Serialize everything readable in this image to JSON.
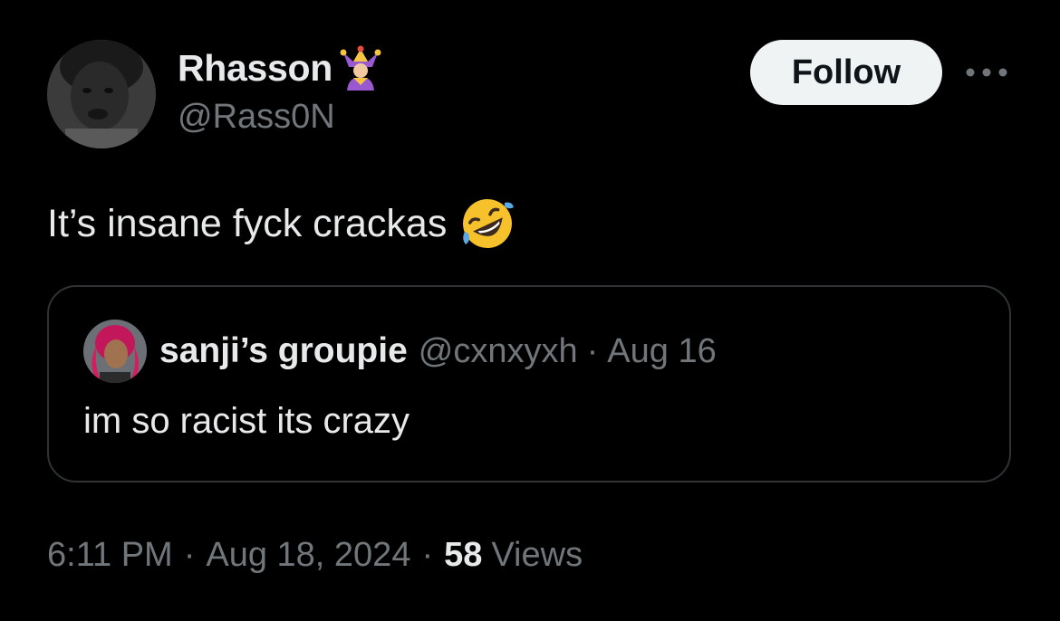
{
  "author": {
    "display_name": "Rhasson",
    "badge_icon": "jester-icon",
    "handle": "@Rass0N",
    "avatar_icon": "avatar-photo"
  },
  "actions": {
    "follow_label": "Follow",
    "more_icon": "more-horizontal-icon"
  },
  "tweet": {
    "text": "It’s insane fyck crackas",
    "emoji_icon": "rolling-on-floor-laughing-icon"
  },
  "quote": {
    "display_name": "sanji’s groupie",
    "handle": "@cxnxyxh",
    "separator": "·",
    "date": "Aug 16",
    "text": "im so racist its crazy"
  },
  "meta": {
    "time": "6:11 PM",
    "separator": "·",
    "date": "Aug 18, 2024",
    "views_count": "58",
    "views_label": "Views"
  },
  "colors": {
    "background": "#000000",
    "primary_text": "#e7e9ea",
    "secondary_text": "#71767b",
    "follow_button_bg": "#eff3f4",
    "border": "#2f3336"
  }
}
